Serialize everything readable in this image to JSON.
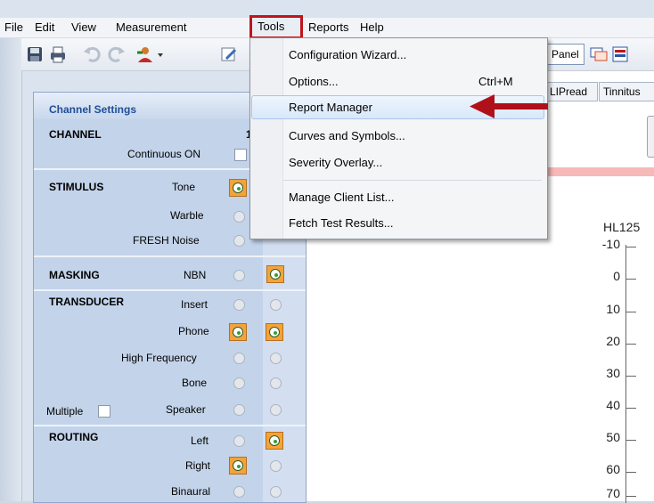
{
  "menubar": {
    "items": [
      "File",
      "Edit",
      "View",
      "Measurement",
      "Tools",
      "Reports",
      "Help"
    ]
  },
  "toolbar": {
    "panel_label": "l Panel"
  },
  "tabs": [
    "LIPread",
    "Tinnitus"
  ],
  "panel": {
    "title": "Channel Settings",
    "channel": {
      "label": "CHANNEL",
      "number": "1",
      "continuous": "Continuous ON"
    },
    "stimulus": {
      "label": "STIMULUS",
      "options": [
        "Tone",
        "Warble",
        "FRESH Noise"
      ]
    },
    "masking": {
      "label": "MASKING",
      "option": "NBN"
    },
    "transducer": {
      "label": "TRANSDUCER",
      "options": [
        "Insert",
        "Phone",
        "High Frequency",
        "Bone",
        "Speaker"
      ],
      "multiple": "Multiple"
    },
    "routing": {
      "label": "ROUTING",
      "options": [
        "Left",
        "Right",
        "Binaural"
      ]
    }
  },
  "dropdown": {
    "items": [
      {
        "label": "Configuration Wizard...",
        "shortcut": ""
      },
      {
        "label": "Options...",
        "shortcut": "Ctrl+M"
      },
      {
        "label": "Report Manager",
        "shortcut": "",
        "highlighted": true
      },
      {
        "label": "Curves and Symbols...",
        "shortcut": ""
      },
      {
        "label": "Severity Overlay...",
        "shortcut": ""
      },
      {
        "label": "Manage Client List...",
        "shortcut": ""
      },
      {
        "label": "Fetch Test Results...",
        "shortcut": ""
      }
    ]
  },
  "audiogram": {
    "header": "HL125",
    "y_ticks": [
      "-10",
      "0",
      "10",
      "20",
      "30",
      "40",
      "50",
      "60",
      "70"
    ]
  },
  "colors": {
    "highlight_box": "#c0141c",
    "selected_radio": "#f3a33a",
    "arrow": "#b0101a"
  }
}
